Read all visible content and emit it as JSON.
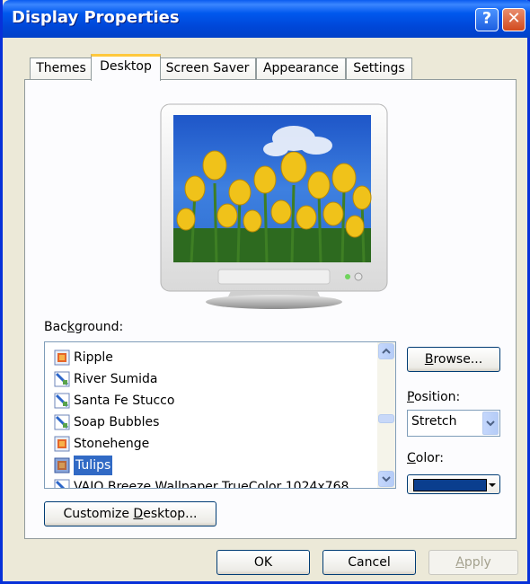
{
  "window": {
    "title": "Display Properties",
    "help_glyph": "?",
    "close_glyph": "✕"
  },
  "tabs": [
    {
      "label": "Themes"
    },
    {
      "label": "Desktop"
    },
    {
      "label": "Screen Saver"
    },
    {
      "label": "Appearance"
    },
    {
      "label": "Settings"
    }
  ],
  "background": {
    "label_pre": "Bac",
    "label_key": "k",
    "label_post": "ground:",
    "items": [
      {
        "label": "Ripple",
        "icon": "image-file-icon"
      },
      {
        "label": "River Sumida",
        "icon": "image-file-icon"
      },
      {
        "label": "Santa Fe Stucco",
        "icon": "image-file-icon"
      },
      {
        "label": "Soap Bubbles",
        "icon": "image-file-icon"
      },
      {
        "label": "Stonehenge",
        "icon": "image-file-icon"
      },
      {
        "label": "Tulips",
        "icon": "image-file-icon",
        "selected": true
      },
      {
        "label": "VAIO Breeze Wallpaper TrueColor 1024x768",
        "icon": "image-file-icon"
      }
    ]
  },
  "browse": {
    "label_key": "B",
    "label_rest": "rowse..."
  },
  "position": {
    "label_key": "P",
    "label_rest": "osition:",
    "value": "Stretch"
  },
  "color": {
    "label_key": "C",
    "label_rest": "olor:",
    "value": "#0A3E8E"
  },
  "customize": {
    "label_pre": "Customize ",
    "label_key": "D",
    "label_post": "esktop..."
  },
  "footer": {
    "ok": "OK",
    "cancel": "Cancel",
    "apply_key": "A",
    "apply_rest": "pply"
  }
}
